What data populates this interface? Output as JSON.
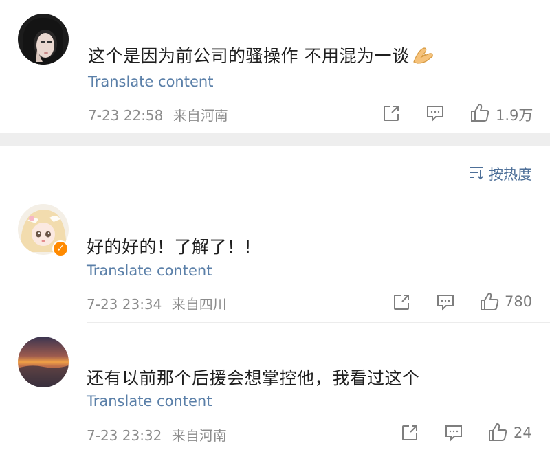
{
  "comments": [
    {
      "text": "这个是因为前公司的骚操作 不用混为一谈",
      "emoji": "hands-together-emoji",
      "translate_label": "Translate content",
      "time": "7-23 22:58",
      "location": "来自河南",
      "likes": "1.9万"
    },
    {
      "text": "好的好的！了解了！!",
      "translate_label": "Translate content",
      "time": "7-23 23:34",
      "location": "来自四川",
      "likes": "780"
    },
    {
      "text": "还有以前那个后援会想掌控他，我看过这个",
      "translate_label": "Translate content",
      "time": "7-23 23:32",
      "location": "来自河南",
      "likes": "24"
    }
  ],
  "sort": {
    "label": "按热度",
    "icon": "sort-icon"
  },
  "icons": {
    "share": "share-icon",
    "comment": "comment-icon",
    "like": "thumbs-up-icon"
  },
  "colors": {
    "link": "#5a7fa8",
    "sort": "#4d6f98",
    "meta": "#8c8c8c",
    "separator": "#eeeeee",
    "vip": "#ff8a00"
  }
}
